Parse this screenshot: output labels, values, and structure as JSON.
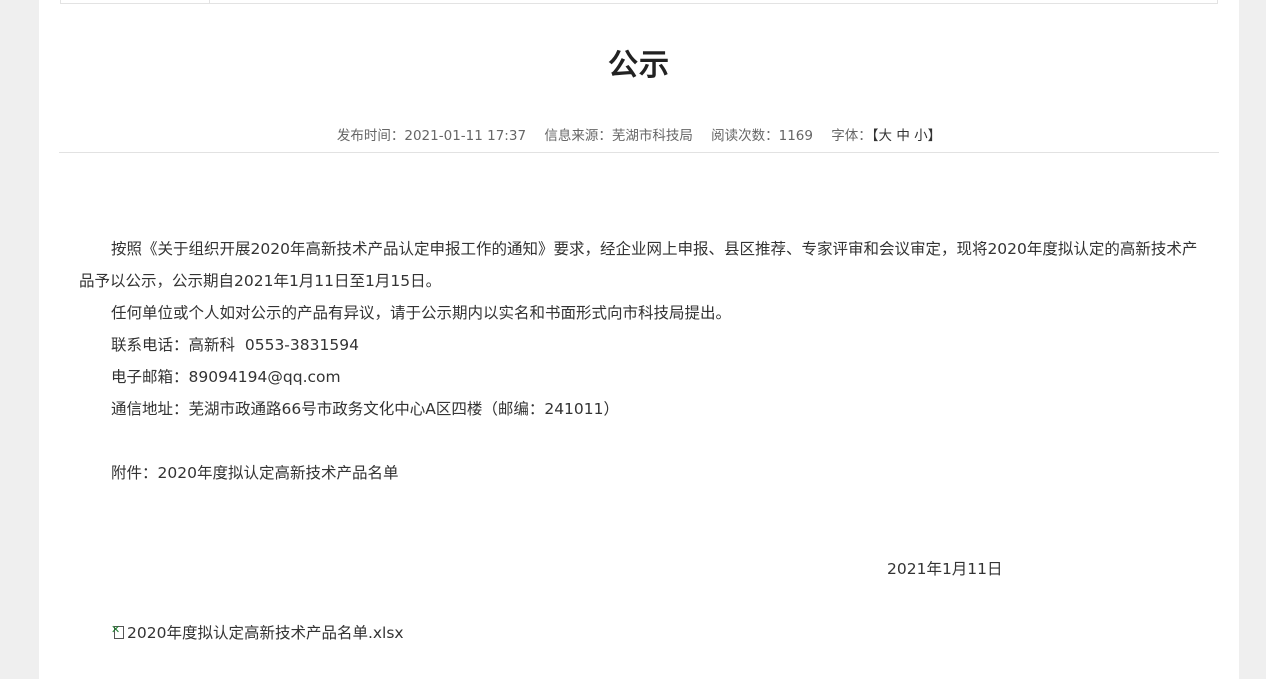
{
  "article": {
    "title": "公示",
    "meta": {
      "publish_label": "发布时间：",
      "publish_time": "2021-01-11 17:37",
      "source_label": "信息来源：",
      "source": "芜湖市科技局",
      "views_label": "阅读次数：",
      "views": "1169",
      "font_label": "字体：",
      "font_open": "【",
      "font_large": "大",
      "font_medium": "中",
      "font_small": "小",
      "font_close": "】"
    },
    "paragraphs": [
      "按照《关于组织开展2020年高新技术产品认定申报工作的通知》要求，经企业网上申报、县区推荐、专家评审和会议审定，现将2020年度拟认定的高新技术产品予以公示，公示期自2021年1月11日至1月15日。",
      "任何单位或个人如对公示的产品有异议，请于公示期内以实名和书面形式向市科技局提出。",
      "联系电话：高新科  0553-3831594",
      "电子邮箱：89094194@qq.com",
      "通信地址：芜湖市政通路66号市政务文化中心A区四楼（邮编：241011）"
    ],
    "attachment_note": "附件：2020年度拟认定高新技术产品名单",
    "date": "2021年1月11日",
    "attachment_file": "2020年度拟认定高新技术产品名单.xlsx",
    "attachment_icon": "excel-file-icon"
  }
}
